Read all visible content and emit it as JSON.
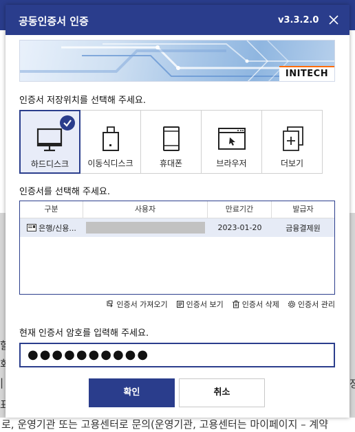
{
  "background": {
    "lines": [
      {
        "text": "할"
      },
      {
        "text": "회,"
      },
      {
        "text": "|"
      },
      {
        "text": "표"
      }
    ],
    "bottom_text": "로, 운영기관 또는 고용센터로 문의(운영기관, 고용센터는 마이페이지 – 계약",
    "right_fragment": "정"
  },
  "dialog": {
    "title": "공동인증서 인증",
    "version": "v3.3.2.0",
    "close_icon": "close-icon",
    "banner_logo": "INITECH",
    "location_prompt": "인증서 저장위치를 선택해 주세요.",
    "locations": [
      {
        "label": "하드디스크",
        "icon": "monitor-icon",
        "selected": true
      },
      {
        "label": "이동식디스크",
        "icon": "usb-drive-icon",
        "selected": false
      },
      {
        "label": "휴대폰",
        "icon": "phone-icon",
        "selected": false
      },
      {
        "label": "브라우저",
        "icon": "browser-icon",
        "selected": false
      },
      {
        "label": "더보기",
        "icon": "more-icon",
        "selected": false
      }
    ],
    "cert_prompt": "인증서를 선택해 주세요.",
    "table": {
      "headers": [
        "구분",
        "사용자",
        "만료기간",
        "발급자"
      ],
      "rows": [
        {
          "type": "은행/신용...",
          "user": "",
          "expiry": "2023-01-20",
          "issuer": "금융결제원"
        }
      ]
    },
    "actions": [
      {
        "label": "인증서 가져오기",
        "icon": "import-icon"
      },
      {
        "label": "인증서 보기",
        "icon": "view-icon"
      },
      {
        "label": "인증서 삭제",
        "icon": "trash-icon"
      },
      {
        "label": "인증서 관리",
        "icon": "gear-icon"
      }
    ],
    "password_prompt": "현재 인증서 암호를 입력해 주세요.",
    "password_value": "●●●●●●●●●●",
    "ok_label": "확인",
    "cancel_label": "취소"
  },
  "colors": {
    "primary": "#2a3d8c",
    "selected_bg": "#e8ecf8",
    "row_selected": "#e6ebf6"
  }
}
